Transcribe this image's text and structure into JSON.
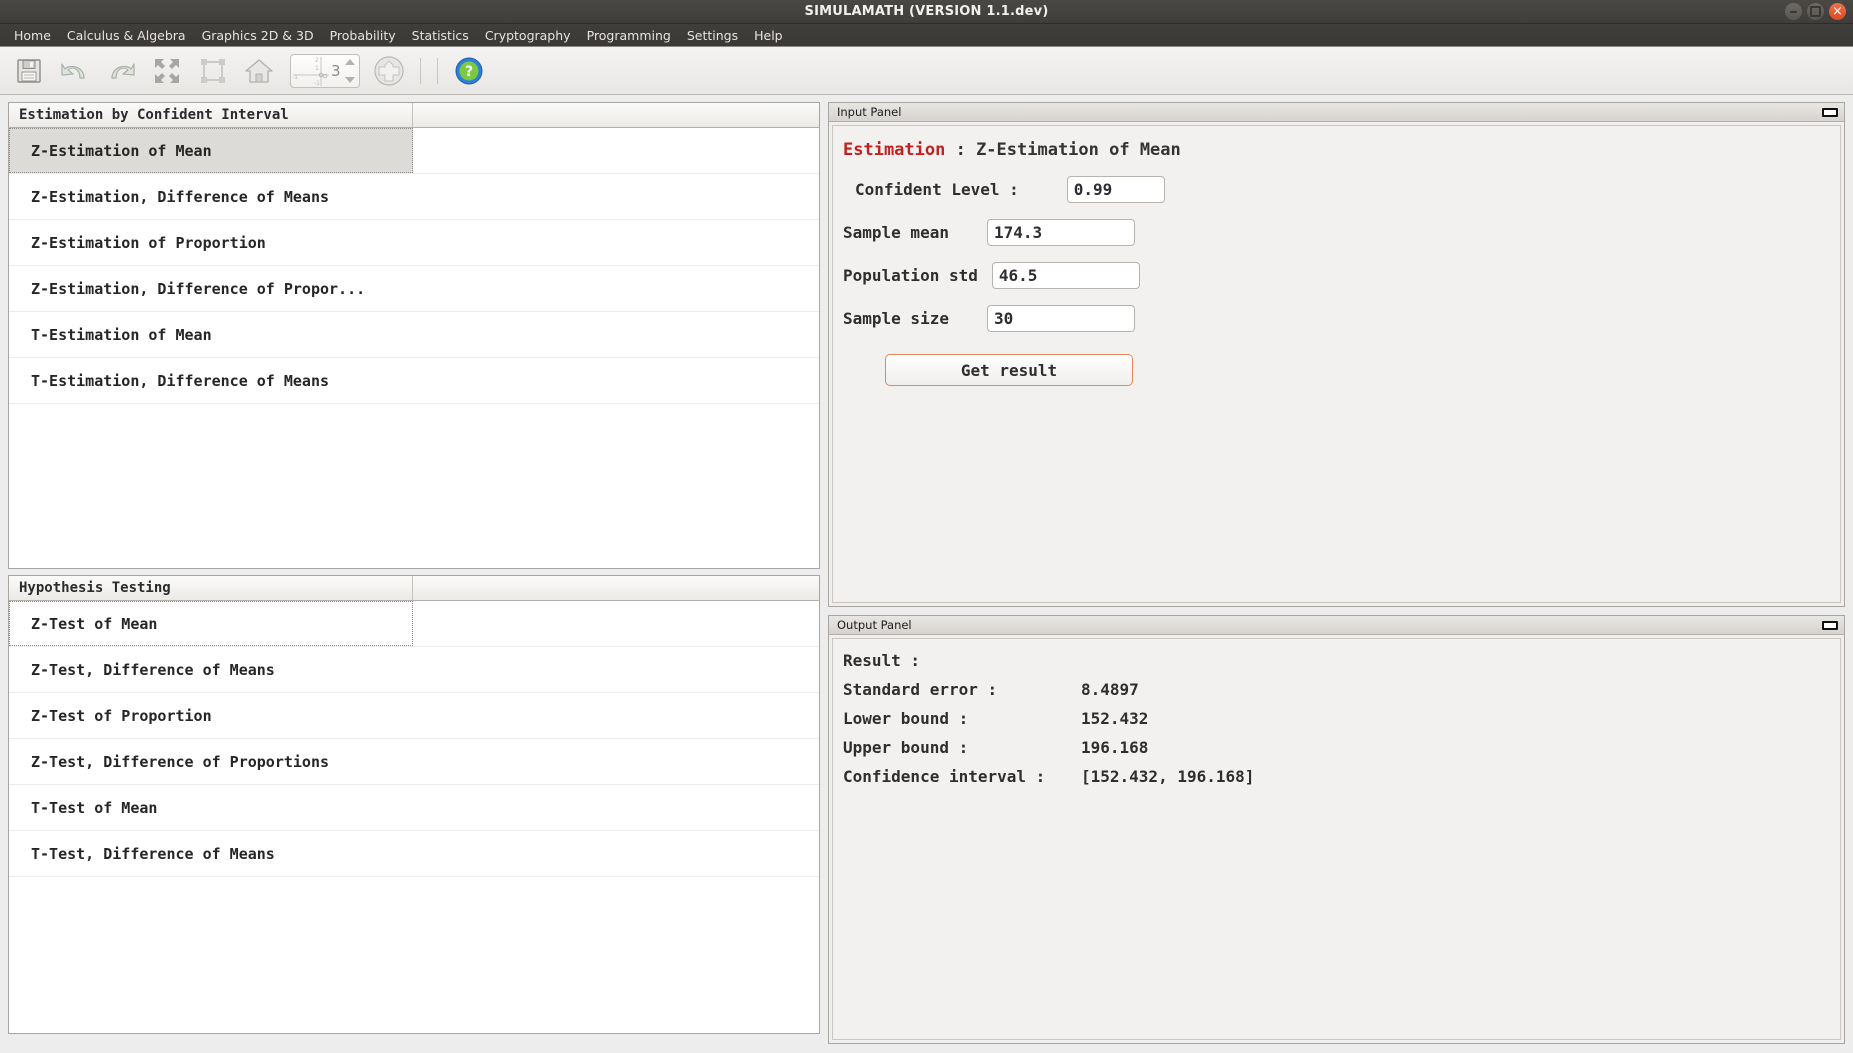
{
  "window": {
    "title": "SIMULAMATH  (VERSION 1.1.dev)",
    "controls": {
      "minimize": "minimize",
      "maximize": "maximize",
      "close": "close"
    }
  },
  "menubar": {
    "items": [
      {
        "label": "Home"
      },
      {
        "label": "Calculus & Algebra"
      },
      {
        "label": "Graphics 2D & 3D"
      },
      {
        "label": "Probability"
      },
      {
        "label": "Statistics"
      },
      {
        "label": "Cryptography"
      },
      {
        "label": "Programming"
      },
      {
        "label": "Settings"
      },
      {
        "label": "Help"
      }
    ]
  },
  "toolbar": {
    "buttons": [
      {
        "name": "save-icon",
        "tooltip": "Save"
      },
      {
        "name": "undo-icon",
        "tooltip": "Undo"
      },
      {
        "name": "redo-icon",
        "tooltip": "Redo"
      },
      {
        "name": "fit-screen-icon",
        "tooltip": "Fit to screen"
      },
      {
        "name": "select-area-icon",
        "tooltip": "Select area"
      },
      {
        "name": "home-icon",
        "tooltip": "Home view"
      }
    ],
    "spinner": {
      "value": "3",
      "axis_labels": [
        "2",
        "1",
        "-1",
        "-1"
      ]
    },
    "add_label": "add",
    "help_label": "help"
  },
  "tables": [
    {
      "id": "estimation",
      "header": "Estimation by Confident Interval",
      "header_col2": "",
      "rows": [
        {
          "label": "Z-Estimation of Mean",
          "state": "selected"
        },
        {
          "label": "Z-Estimation, Difference of Means",
          "state": "normal"
        },
        {
          "label": "Z-Estimation of Proportion",
          "state": "normal"
        },
        {
          "label": "Z-Estimation, Difference of Propor...",
          "state": "normal"
        },
        {
          "label": "T-Estimation of Mean",
          "state": "normal"
        },
        {
          "label": "T-Estimation, Difference of Means",
          "state": "normal"
        }
      ]
    },
    {
      "id": "hypothesis",
      "header": "Hypothesis Testing",
      "header_col2": "",
      "rows": [
        {
          "label": "Z-Test of Mean",
          "state": "focused"
        },
        {
          "label": "Z-Test, Difference of Means",
          "state": "normal"
        },
        {
          "label": "Z-Test of Proportion",
          "state": "normal"
        },
        {
          "label": "Z-Test, Difference of Proportions",
          "state": "normal"
        },
        {
          "label": "T-Test of Mean",
          "state": "normal"
        },
        {
          "label": "T-Test, Difference of Means",
          "state": "normal"
        }
      ]
    }
  ],
  "input_panel": {
    "title": "Input Panel",
    "minimize_label": "minimize",
    "heading_highlight": "Estimation",
    "heading_rest": " : Z-Estimation of Mean",
    "fields": [
      {
        "label": "Confident Level :",
        "value": "0.99"
      },
      {
        "label": "Sample mean",
        "value": "174.3"
      },
      {
        "label": "Population std",
        "value": "46.5"
      },
      {
        "label": "Sample size",
        "value": "30"
      }
    ],
    "button_label": "Get result"
  },
  "output_panel": {
    "title": "Output Panel",
    "minimize_label": "minimize",
    "result_label": "Result :",
    "lines": [
      {
        "key": "Standard error :",
        "value": "8.4897"
      },
      {
        "key": "Lower bound :",
        "value": "152.432"
      },
      {
        "key": "Upper bound :",
        "value": "196.168"
      },
      {
        "key": "Confidence interval :",
        "value": "[152.432, 196.168]"
      }
    ]
  },
  "colors": {
    "accent_red": "#c02020",
    "accent_orange": "#e08a5c",
    "titlebar": "#403e3b",
    "panel_bg": "#f2f1ef",
    "selection": "#dddbd8"
  }
}
